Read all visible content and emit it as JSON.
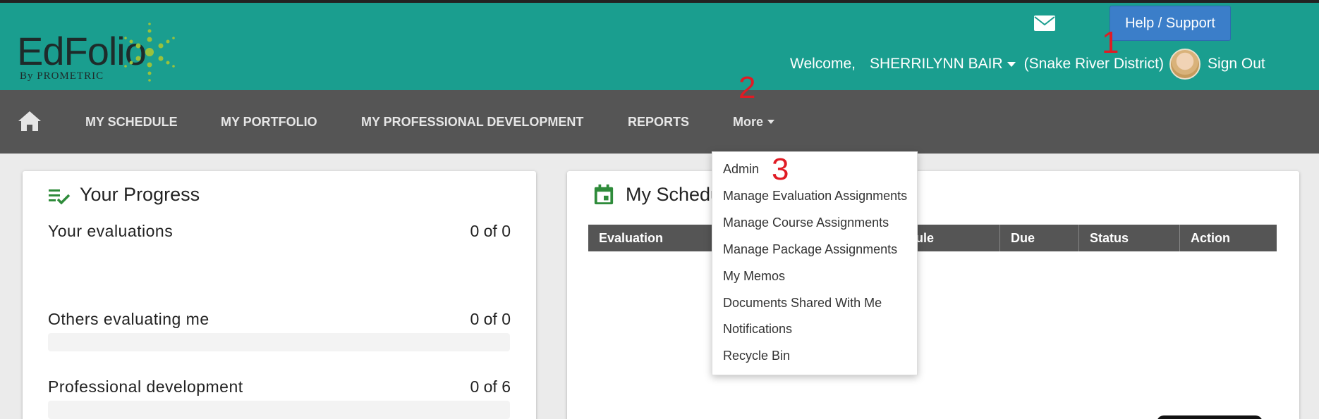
{
  "header": {
    "logo": {
      "name": "EdFolio",
      "sub": "By PROMETRIC"
    },
    "help_label": "Help / Support",
    "welcome": "Welcome,",
    "username": "SHERRILYNN BAIR",
    "district": "(Snake River District)",
    "signout": "Sign Out",
    "annotation_1": "1",
    "icons": {
      "mail": "mail-icon",
      "caret": "caret-down-icon",
      "avatar": "user-avatar"
    }
  },
  "nav": {
    "items": [
      "MY SCHEDULE",
      "MY PORTFOLIO",
      "MY PROFESSIONAL DEVELOPMENT",
      "REPORTS"
    ],
    "more_label": "More",
    "annotation_2": "2",
    "icons": {
      "home": "home-icon"
    }
  },
  "progress_card": {
    "title": "Your Progress",
    "rows": [
      {
        "label": "Your evaluations",
        "value": "0 of 0"
      },
      {
        "label": "Others evaluating me",
        "value": "0 of 0"
      },
      {
        "label": "Professional development",
        "value": "0 of 6"
      }
    ]
  },
  "schedule_card": {
    "title": "My Schedu",
    "columns": [
      "Evaluation",
      "ule",
      "Due",
      "Status",
      "Action"
    ]
  },
  "more_menu": {
    "items": [
      "Admin",
      "Manage Evaluation Assignments",
      "Manage Course Assignments",
      "Manage Package Assignments",
      "My Memos",
      "Documents Shared With Me",
      "Notifications",
      "Recycle Bin"
    ],
    "annotation_3": "3"
  },
  "colors": {
    "header_bg": "#1a9e8f",
    "nav_bg": "#555555",
    "help_button": "#3b7ec9",
    "icon_green": "#2e8b3a",
    "annotation_red": "#e01b24"
  }
}
